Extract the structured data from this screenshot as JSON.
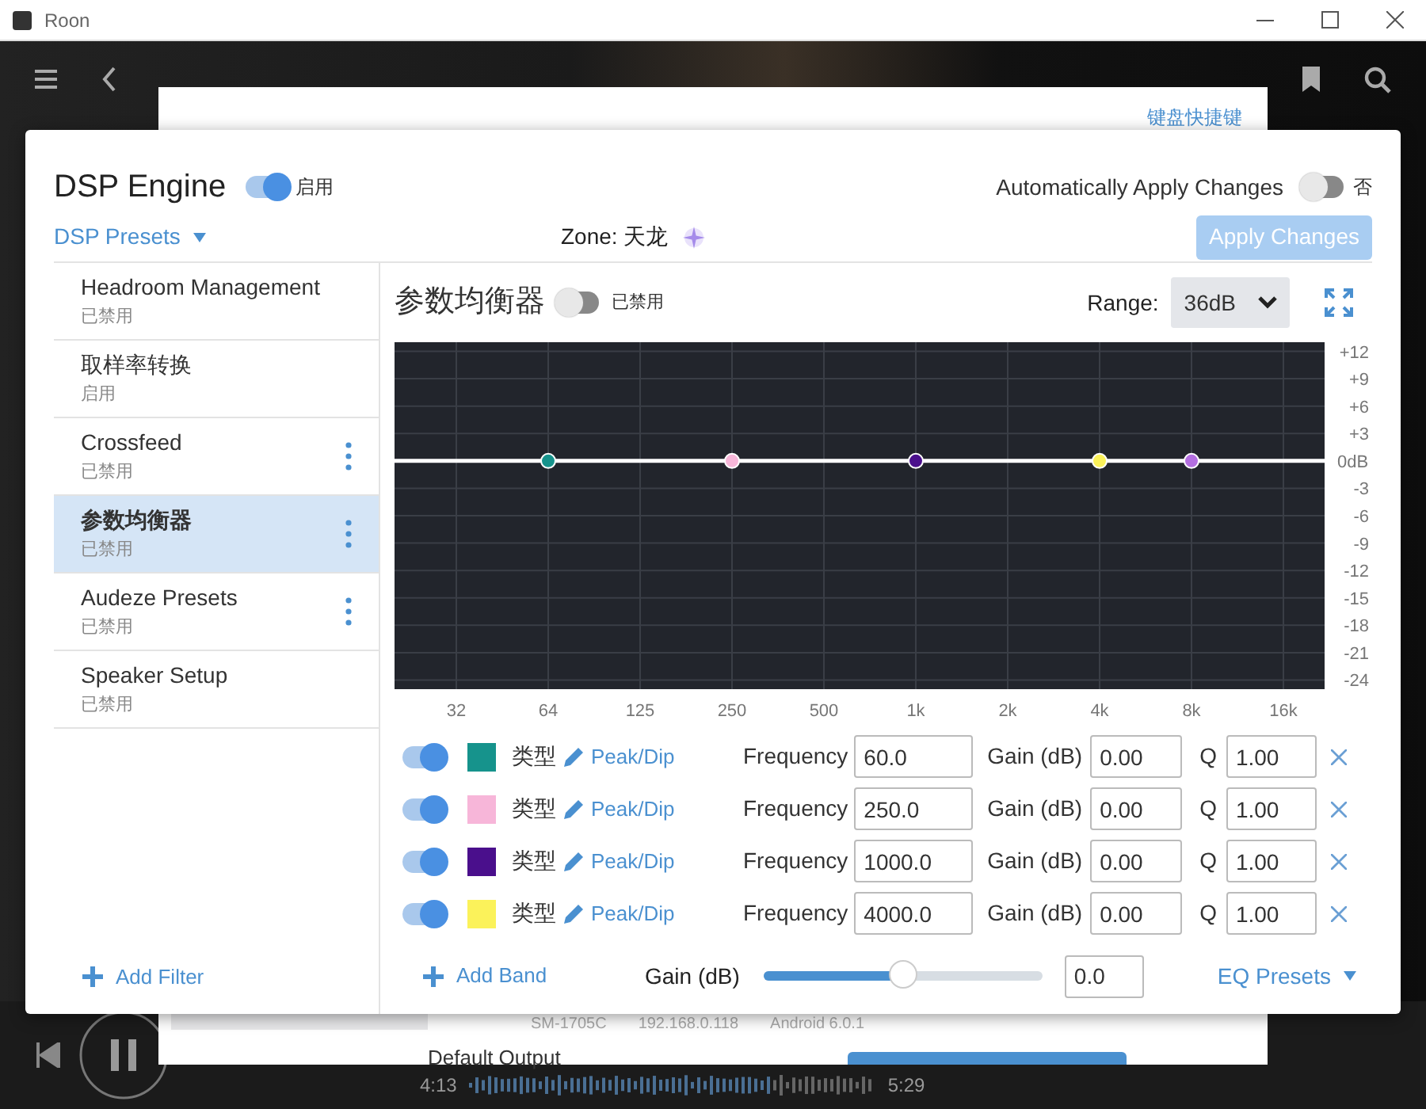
{
  "window": {
    "title": "Roon"
  },
  "settings_panel": {
    "shortcuts_link": "键盘快捷键",
    "device": {
      "model": "SM-1705C",
      "ip": "192.168.0.118",
      "os": "Android 6.0.1",
      "output": "Default Output"
    }
  },
  "player": {
    "elapsed": "4:13",
    "total": "5:29"
  },
  "dsp": {
    "title": "DSP Engine",
    "enabled": true,
    "enabled_label": "启用",
    "auto_apply_label": "Automatically Apply Changes",
    "auto_apply": false,
    "auto_apply_value": "否",
    "presets": "DSP Presets",
    "zone": "Zone: 天龙",
    "apply_button": {
      "label": "Apply Changes",
      "disabled": true
    },
    "filters": [
      {
        "name": "Headroom Management",
        "status": "已禁用",
        "selected": false,
        "has_menu": false
      },
      {
        "name": "取样率转换",
        "status": "启用",
        "selected": false,
        "has_menu": false
      },
      {
        "name": "Crossfeed",
        "status": "已禁用",
        "selected": false,
        "has_menu": true
      },
      {
        "name": "参数均衡器",
        "status": "已禁用",
        "selected": true,
        "has_menu": true
      },
      {
        "name": "Audeze Presets",
        "status": "已禁用",
        "selected": false,
        "has_menu": true
      },
      {
        "name": "Speaker Setup",
        "status": "已禁用",
        "selected": false,
        "has_menu": false
      }
    ],
    "add_filter": "Add Filter",
    "eq": {
      "title": "参数均衡器",
      "enabled": false,
      "status": "已禁用",
      "range_label": "Range:",
      "range": "36dB",
      "chart_data": {
        "type": "scatter",
        "grid": true,
        "ylim": [
          -25,
          13
        ],
        "categories": [
          "32",
          "64",
          "125",
          "250",
          "500",
          "1k",
          "2k",
          "4k",
          "8k",
          "16k"
        ],
        "yticks": [
          {
            "value": 12,
            "label": "+12"
          },
          {
            "value": 9,
            "label": "+9"
          },
          {
            "value": 6,
            "label": "+6"
          },
          {
            "value": 3,
            "label": "+3"
          },
          {
            "value": 0,
            "label": "0dB"
          },
          -3,
          -6,
          -9,
          -12,
          -15,
          -18,
          -21,
          -24
        ],
        "series": [
          {
            "color": "#16938c",
            "values": [
              null,
              0,
              null,
              null,
              null,
              null,
              null,
              null,
              null,
              null
            ]
          },
          {
            "color": "#f7b6d9",
            "values": [
              null,
              null,
              null,
              0,
              null,
              null,
              null,
              null,
              null,
              null
            ]
          },
          {
            "color": "#4a0f8c",
            "values": [
              null,
              null,
              null,
              null,
              null,
              0,
              null,
              null,
              null,
              null
            ]
          },
          {
            "color": "#fbf25a",
            "values": [
              null,
              null,
              null,
              null,
              null,
              null,
              null,
              0,
              null,
              null
            ]
          },
          {
            "color": "#b36ee0",
            "values": [
              null,
              null,
              null,
              null,
              null,
              null,
              null,
              null,
              0,
              null
            ]
          }
        ]
      },
      "bands": [
        {
          "enabled": true,
          "color": "#16938c",
          "type_label": "类型",
          "type": "Peak/Dip",
          "frequency_label": "Frequency",
          "frequency": "60.0",
          "gain_label": "Gain (dB)",
          "gain": "0.00",
          "q_label": "Q",
          "q": "1.00"
        },
        {
          "enabled": true,
          "color": "#f7b6d9",
          "type_label": "类型",
          "type": "Peak/Dip",
          "frequency_label": "Frequency",
          "frequency": "250.0",
          "gain_label": "Gain (dB)",
          "gain": "0.00",
          "q_label": "Q",
          "q": "1.00"
        },
        {
          "enabled": true,
          "color": "#4a0f8c",
          "type_label": "类型",
          "type": "Peak/Dip",
          "frequency_label": "Frequency",
          "frequency": "1000.0",
          "gain_label": "Gain (dB)",
          "gain": "0.00",
          "q_label": "Q",
          "q": "1.00"
        },
        {
          "enabled": true,
          "color": "#fbf25a",
          "type_label": "类型",
          "type": "Peak/Dip",
          "frequency_label": "Frequency",
          "frequency": "4000.0",
          "gain_label": "Gain (dB)",
          "gain": "0.00",
          "q_label": "Q",
          "q": "1.00"
        }
      ],
      "add_band": "Add Band",
      "gain_label": "Gain (dB)",
      "gain_slider": {
        "level": 0.5
      },
      "gain_value": "0.0",
      "eq_presets": "EQ Presets"
    }
  }
}
